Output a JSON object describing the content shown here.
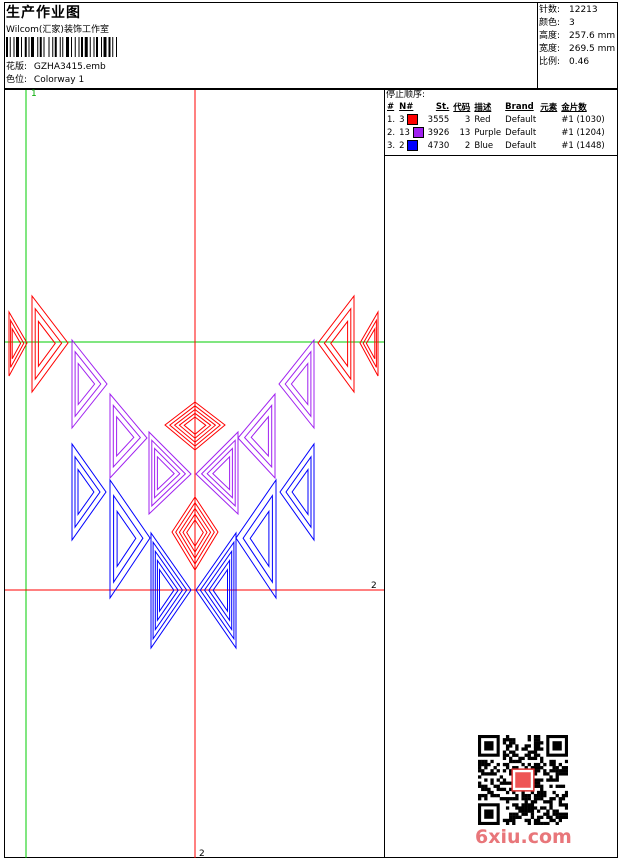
{
  "header": {
    "title": "生产作业图",
    "subtitle": "Wilcom(汇家)装饰工作室",
    "design_label": "花版:",
    "design_file": "GZHA3415.emb",
    "colorway_label": "色位:",
    "colorway": "Colorway 1"
  },
  "stats": [
    {
      "label": "针数:",
      "value": "12213"
    },
    {
      "label": "颜色:",
      "value": "3"
    },
    {
      "label": "高度:",
      "value": "257.6 mm"
    },
    {
      "label": "宽度:",
      "value": "269.5 mm"
    },
    {
      "label": "比例:",
      "value": "0.46"
    }
  ],
  "stop_sequence": {
    "title": "停止顺序:",
    "headers": [
      "#",
      "N#",
      "St.",
      "代码",
      "描述",
      "Brand",
      "元素",
      "金片数"
    ],
    "rows": [
      {
        "index": "1.",
        "n": "3",
        "color": "#ff0000",
        "stitches": "3555",
        "code": "3",
        "desc": "Red",
        "brand": "Default",
        "element": "",
        "sequins": "#1 (1030)"
      },
      {
        "index": "2.",
        "n": "13",
        "color": "#a020f0",
        "stitches": "3926",
        "code": "13",
        "desc": "Purple",
        "brand": "Default",
        "element": "",
        "sequins": "#1 (1204)"
      },
      {
        "index": "3.",
        "n": "2",
        "color": "#0000ff",
        "stitches": "4730",
        "code": "2",
        "desc": "Blue",
        "brand": "Default",
        "element": "",
        "sequins": "#1 (1448)"
      }
    ]
  },
  "axes": {
    "green_label": "1",
    "red_label": "2"
  },
  "colors": {
    "red": "#ff0000",
    "purple": "#a020f0",
    "blue": "#0000ff",
    "green": "#00cc00",
    "watermark": "#e8767a"
  },
  "watermark": "6xiu.com"
}
